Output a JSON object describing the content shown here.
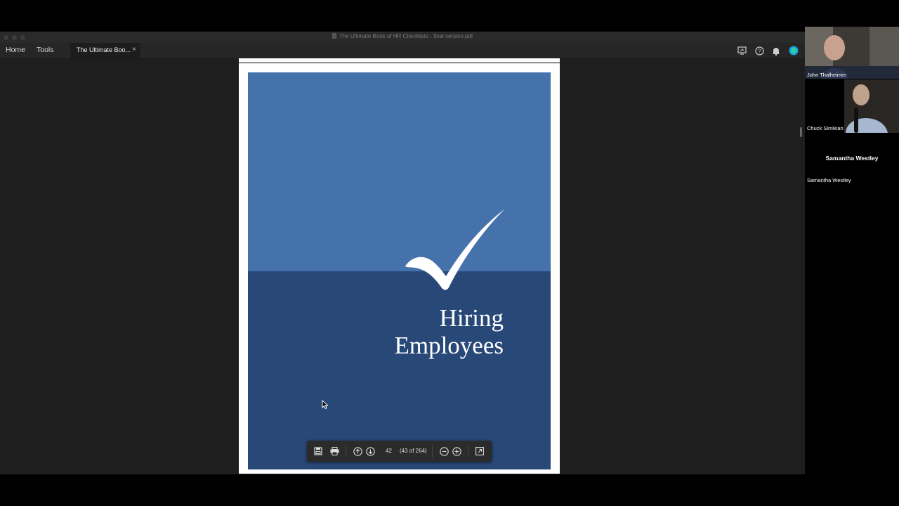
{
  "window": {
    "title": "The Ultimate Book of HR Checklists - final version.pdf"
  },
  "menu": {
    "home": "Home",
    "tools": "Tools"
  },
  "tab": {
    "label": "The Ultimate Boo...",
    "close": "×"
  },
  "toolbar_icons": [
    "screen-share-icon",
    "help-icon",
    "bell-icon",
    "avatar-icon"
  ],
  "document": {
    "cover_title_line1": "Hiring",
    "cover_title_line2": "Employees",
    "colors": {
      "top": "#4672ac",
      "bottom": "#284878"
    }
  },
  "pdf_toolbar": {
    "page_number": "42",
    "page_count": "(43 of 264)"
  },
  "participants": {
    "john": {
      "name": "John Thalheimer"
    },
    "chuck": {
      "name": "Chuck Simikian"
    },
    "samantha": {
      "display": "Samantha Westley",
      "name": "Samantha Westley"
    }
  }
}
